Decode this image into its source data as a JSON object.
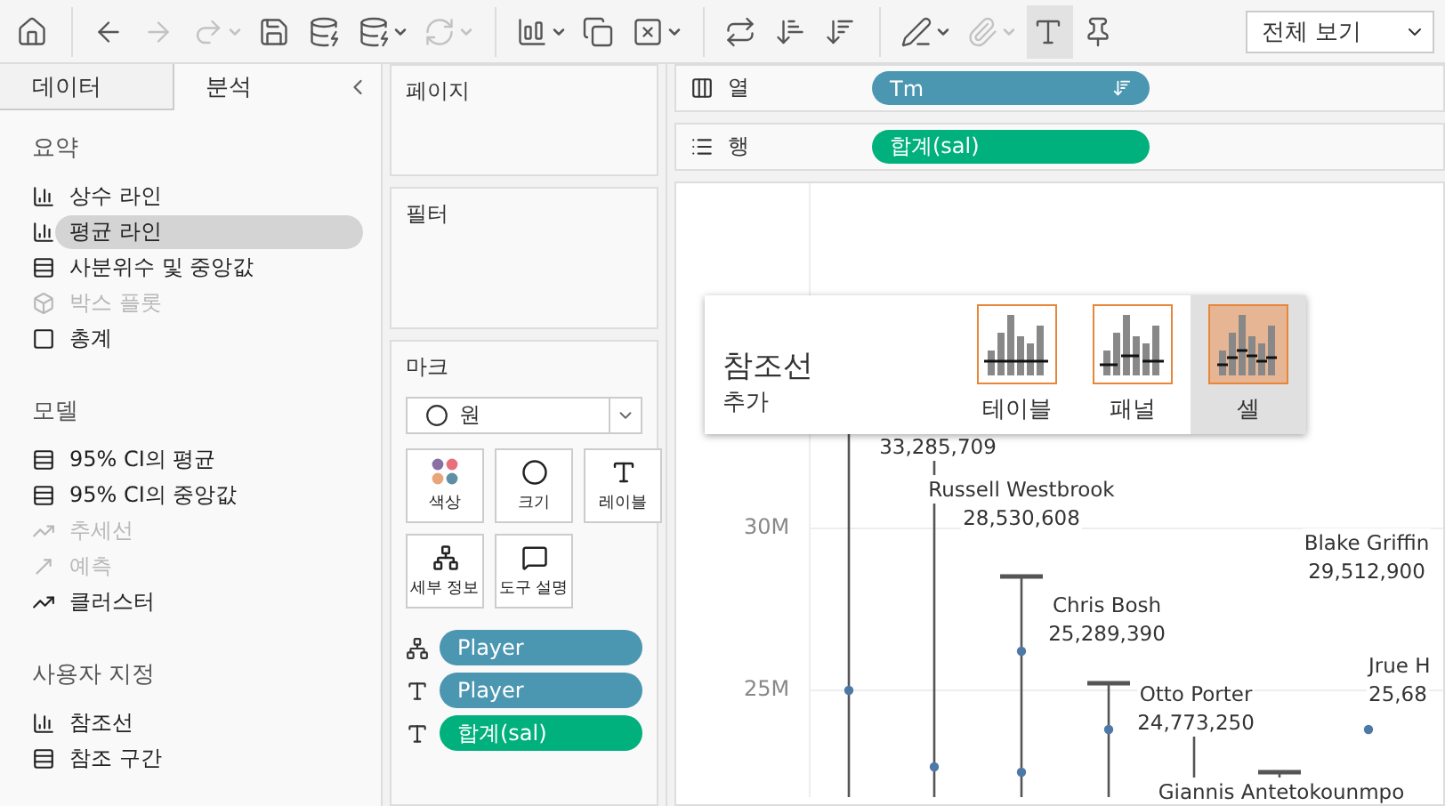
{
  "toolbar": [
    {
      "kind": "home",
      "disabled": false,
      "caret": false,
      "selected": false
    },
    {
      "kind": "back",
      "disabled": false,
      "caret": false,
      "selected": false
    },
    {
      "kind": "forward",
      "disabled": true,
      "caret": false,
      "selected": false
    },
    {
      "kind": "redo",
      "disabled": true,
      "caret": true,
      "selected": false
    },
    {
      "kind": "save",
      "disabled": false,
      "caret": false,
      "selected": false
    },
    {
      "kind": "add-data",
      "disabled": false,
      "caret": false,
      "selected": false
    },
    {
      "kind": "pause",
      "disabled": false,
      "caret": true,
      "selected": false
    },
    {
      "kind": "refresh",
      "disabled": true,
      "caret": true,
      "selected": false
    },
    {
      "kind": "new-sheet",
      "disabled": false,
      "caret": true,
      "selected": false
    },
    {
      "kind": "duplicate",
      "disabled": false,
      "caret": false,
      "selected": false
    },
    {
      "kind": "clear",
      "disabled": false,
      "caret": true,
      "selected": false
    },
    {
      "kind": "swap",
      "disabled": false,
      "caret": false,
      "selected": false
    },
    {
      "kind": "sort-asc",
      "disabled": false,
      "caret": false,
      "selected": false
    },
    {
      "kind": "sort-desc",
      "disabled": false,
      "caret": false,
      "selected": false
    },
    {
      "kind": "highlight",
      "disabled": false,
      "caret": true,
      "selected": false
    },
    {
      "kind": "attach",
      "disabled": true,
      "caret": true,
      "selected": false
    },
    {
      "kind": "labels",
      "disabled": false,
      "caret": false,
      "selected": true
    },
    {
      "kind": "pin",
      "disabled": false,
      "caret": false,
      "selected": false
    }
  ],
  "view_select": {
    "value": "전체 보기"
  },
  "side_tabs": [
    {
      "label": "데이터",
      "selected": false
    },
    {
      "label": "분석",
      "selected": true
    }
  ],
  "sections": [
    {
      "title": "요약",
      "items": [
        {
          "label": "상수 라인",
          "disabled": false,
          "selected": false
        },
        {
          "label": "평균 라인",
          "disabled": false,
          "selected": true
        },
        {
          "label": "사분위수 및 중앙값",
          "disabled": false,
          "selected": false
        },
        {
          "label": "박스 플롯",
          "disabled": true,
          "selected": false
        },
        {
          "label": "총계",
          "disabled": false,
          "selected": false
        }
      ]
    },
    {
      "title": "모델",
      "items": [
        {
          "label": "95% CI의 평균",
          "disabled": false,
          "selected": false
        },
        {
          "label": "95% CI의 중앙값",
          "disabled": false,
          "selected": false
        },
        {
          "label": "추세선",
          "disabled": true,
          "selected": false
        },
        {
          "label": "예측",
          "disabled": true,
          "selected": false
        },
        {
          "label": "클러스터",
          "disabled": false,
          "selected": false
        }
      ]
    },
    {
      "title": "사용자 지정",
      "items": [
        {
          "label": "참조선",
          "disabled": false,
          "selected": false
        },
        {
          "label": "참조 구간",
          "disabled": false,
          "selected": false
        }
      ]
    }
  ],
  "pages": {
    "title": "페이지"
  },
  "filters": {
    "title": "필터"
  },
  "marks": {
    "title": "마크",
    "mark_type": "원",
    "cards": [
      {
        "kind": "color",
        "label": "색상"
      },
      {
        "kind": "size",
        "label": "크기"
      },
      {
        "kind": "label",
        "label": "레이블"
      },
      {
        "kind": "detail",
        "label": "세부 정보"
      },
      {
        "kind": "tooltip",
        "label": "도구 설명"
      }
    ],
    "pills": [
      {
        "kind": "detail",
        "label": "Player",
        "color": "#4b96b1"
      },
      {
        "kind": "label",
        "label": "Player",
        "color": "#4b96b1"
      },
      {
        "kind": "label",
        "label": "합계(sal)",
        "color": "#00b07d"
      }
    ]
  },
  "columns": {
    "label": "열",
    "pill": {
      "label": "Tm",
      "color": "#4b96b1",
      "sorted": true
    }
  },
  "rows": {
    "label": "행",
    "pill": {
      "label": "합계(sal)",
      "color": "#00b07d",
      "sorted": false
    }
  },
  "view": {
    "y_ticks": [
      "30M",
      "25M"
    ],
    "labels": [
      {
        "lines": [
          "33,285,709"
        ]
      },
      {
        "lines": [
          "Russell Westbrook",
          "28,530,608"
        ]
      },
      {
        "lines": [
          "Blake Griffin",
          "29,512,900"
        ]
      },
      {
        "lines": [
          "Chris Bosh",
          "25,289,390"
        ]
      },
      {
        "lines": [
          "Otto Porter",
          "24,773,250"
        ]
      },
      {
        "lines": [
          "Jrue H",
          "25,68"
        ]
      },
      {
        "lines": [
          "Giannis Antetokounmpo"
        ]
      }
    ]
  },
  "popup": {
    "title": "참조선",
    "subtitle": "추가",
    "options": [
      {
        "label": "테이블",
        "kind": "table",
        "selected": false
      },
      {
        "label": "패널",
        "kind": "pane",
        "selected": false
      },
      {
        "label": "셀",
        "kind": "cell",
        "selected": true
      }
    ]
  }
}
